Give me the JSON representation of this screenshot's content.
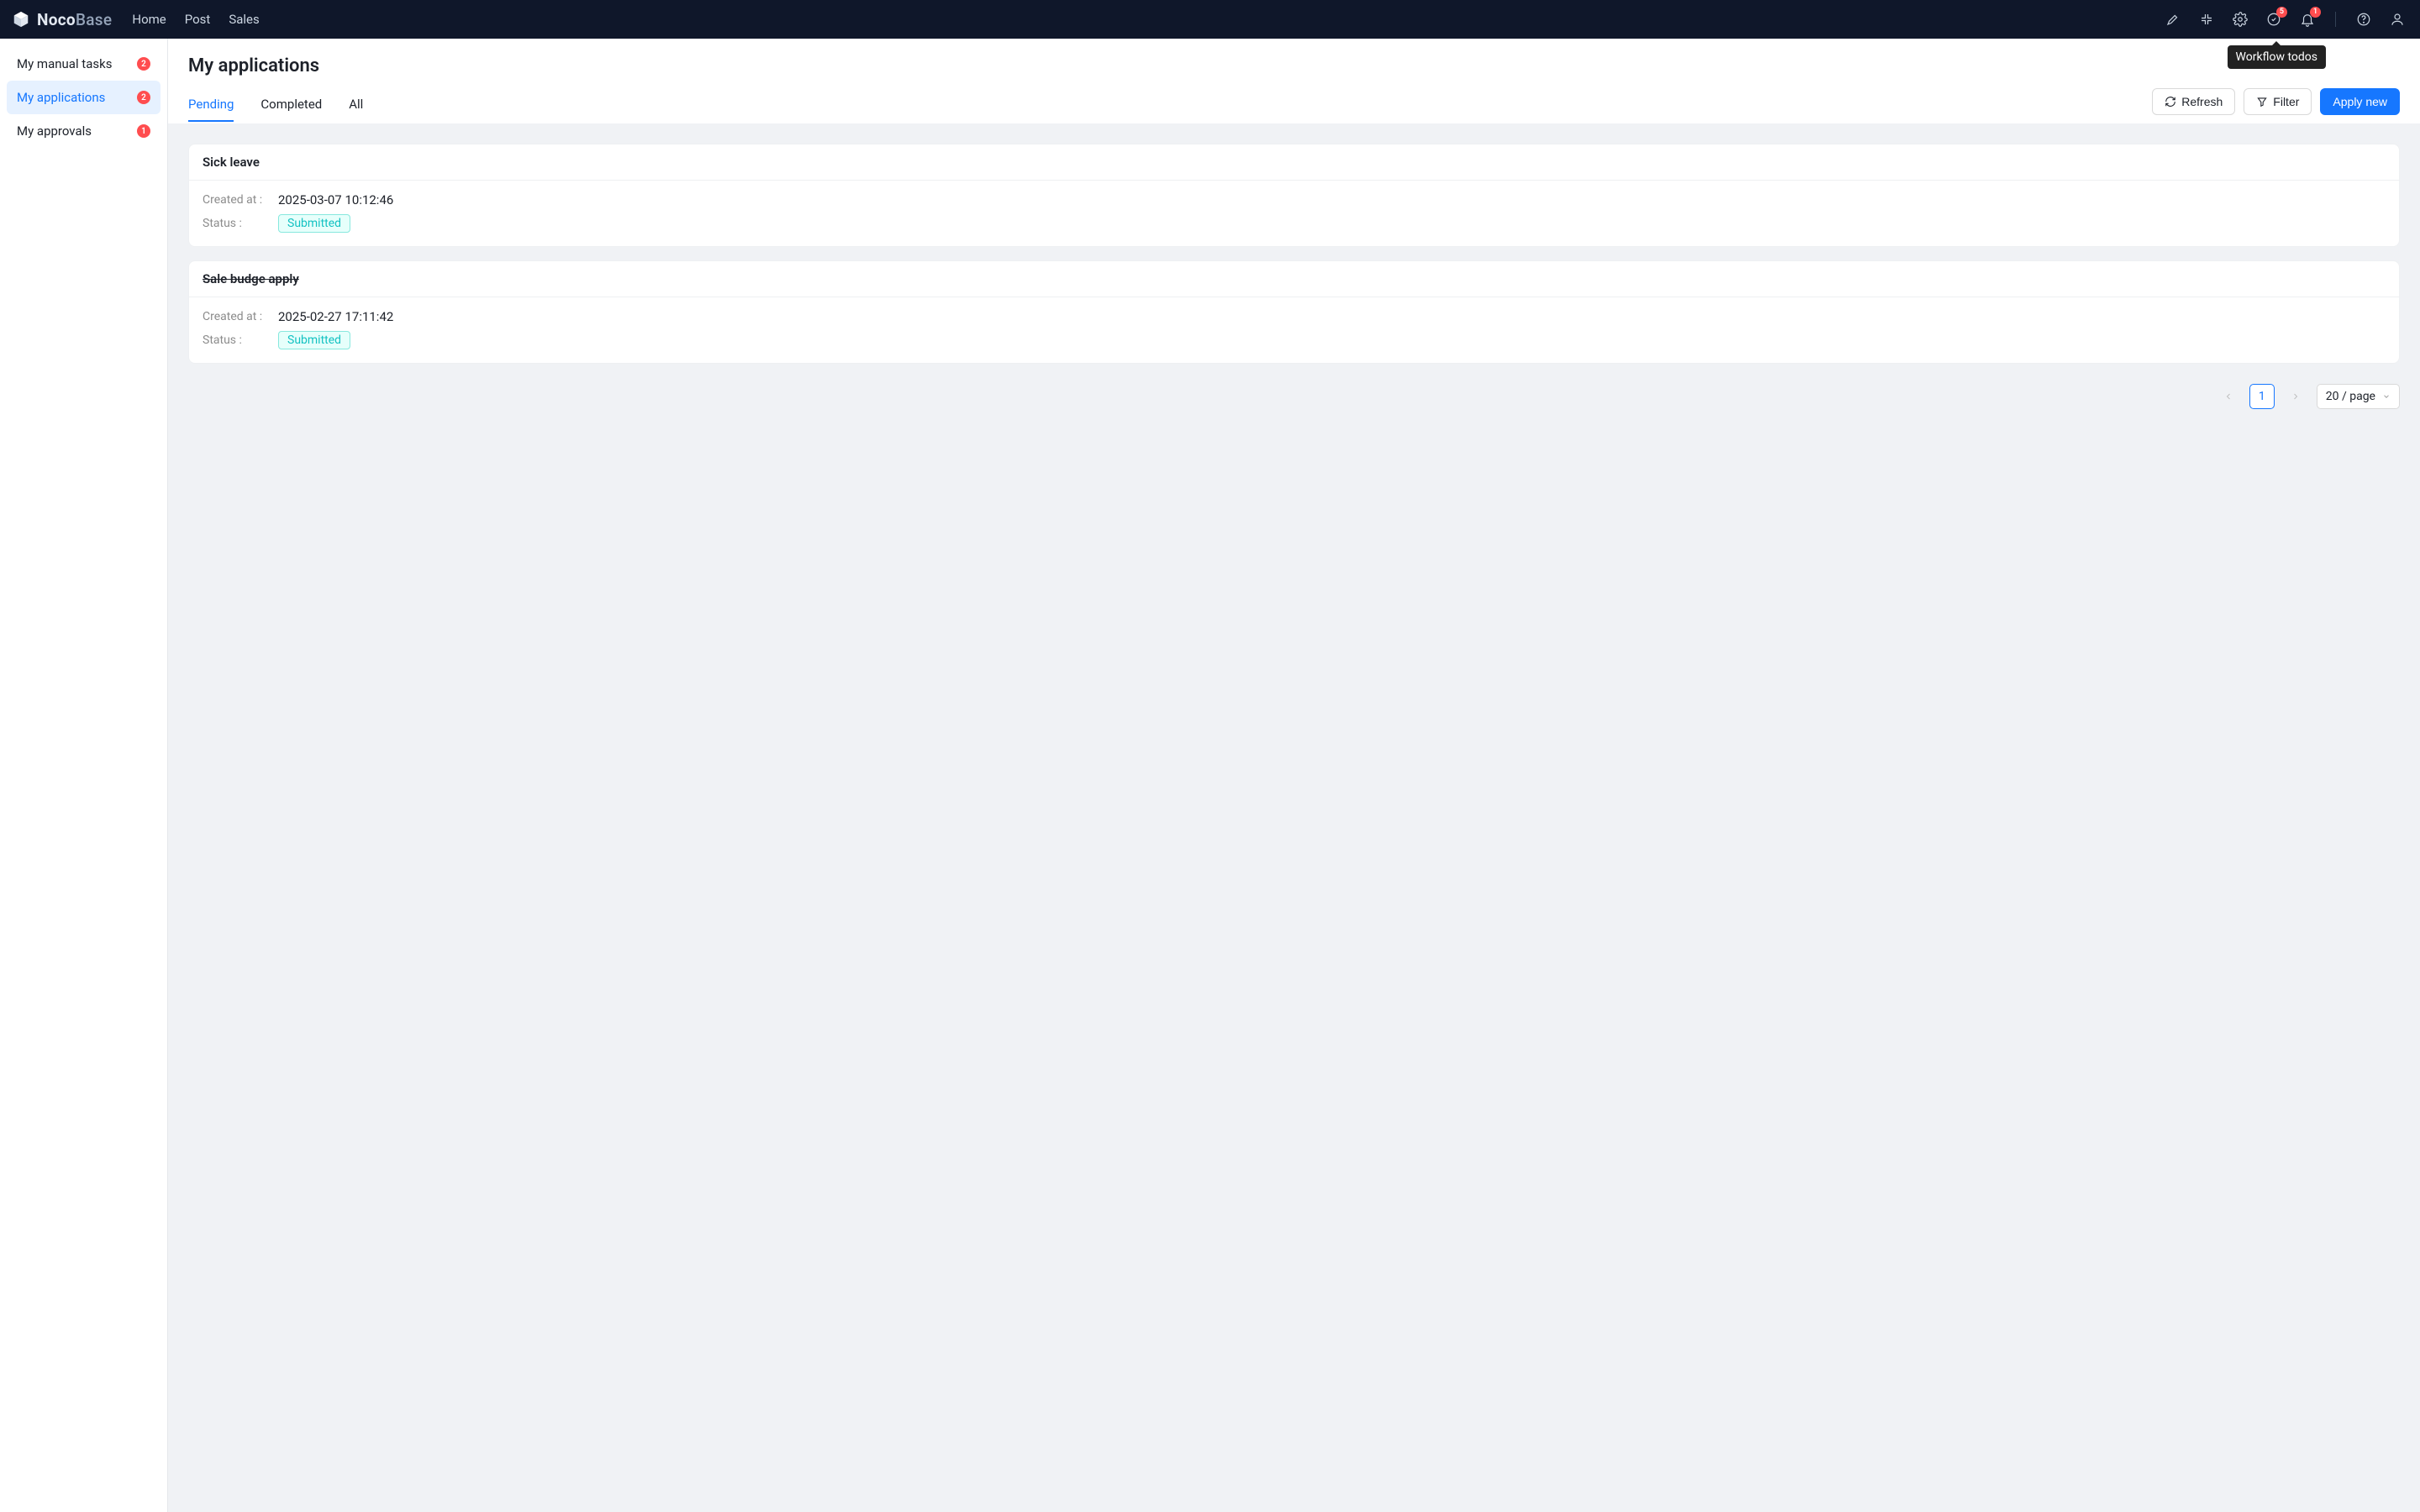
{
  "brand": {
    "name": "Noco",
    "suffix": "Base"
  },
  "nav": {
    "links": [
      "Home",
      "Post",
      "Sales"
    ]
  },
  "nav_badges": {
    "todos": "5",
    "bell": "1"
  },
  "tooltip": "Workflow todos",
  "sidebar": {
    "items": [
      {
        "label": "My manual tasks",
        "badge": "2",
        "active": false
      },
      {
        "label": "My applications",
        "badge": "2",
        "active": true
      },
      {
        "label": "My approvals",
        "badge": "1",
        "active": false
      }
    ]
  },
  "page": {
    "title": "My applications"
  },
  "tabs": [
    "Pending",
    "Completed",
    "All"
  ],
  "actions": {
    "refresh": "Refresh",
    "filter": "Filter",
    "apply": "Apply new"
  },
  "field_labels": {
    "created_at": "Created at :",
    "status": "Status :"
  },
  "items": [
    {
      "title": "Sick leave",
      "strike": false,
      "created_at": "2025-03-07 10:12:46",
      "status": "Submitted"
    },
    {
      "title": "Sale budge apply",
      "strike": true,
      "created_at": "2025-02-27 17:11:42",
      "status": "Submitted"
    }
  ],
  "pager": {
    "current": "1",
    "size_label": "20 / page"
  }
}
